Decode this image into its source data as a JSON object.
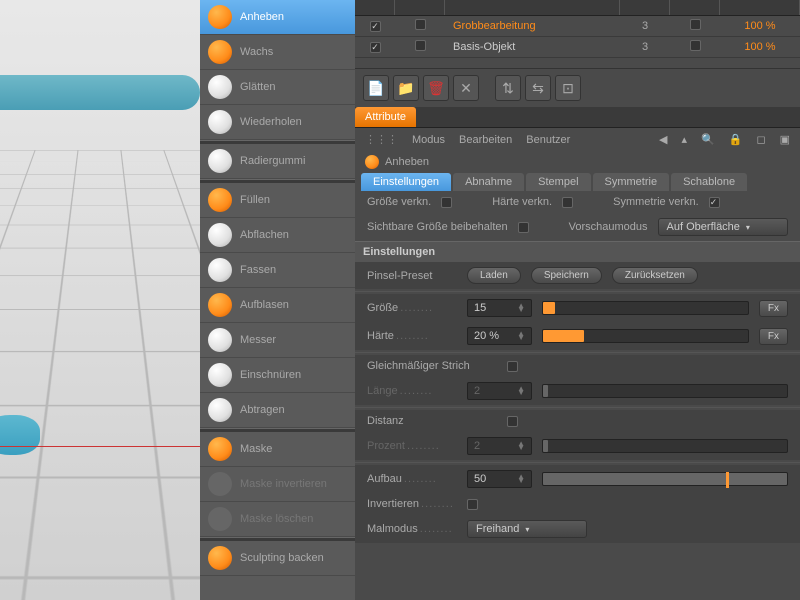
{
  "tools": {
    "group1": [
      {
        "id": "anheben",
        "label": "Anheben",
        "icon": "orange",
        "sel": true
      },
      {
        "id": "wachs",
        "label": "Wachs",
        "icon": "orange"
      },
      {
        "id": "glaetten",
        "label": "Glätten",
        "icon": "white"
      },
      {
        "id": "wiederholen",
        "label": "Wiederholen",
        "icon": "white"
      }
    ],
    "group2": [
      {
        "id": "radiergummi",
        "label": "Radiergummi",
        "icon": "white"
      }
    ],
    "group3": [
      {
        "id": "fuellen",
        "label": "Füllen",
        "icon": "orange"
      },
      {
        "id": "abflachen",
        "label": "Abflachen",
        "icon": "white"
      },
      {
        "id": "fassen",
        "label": "Fassen",
        "icon": "white"
      },
      {
        "id": "aufblasen",
        "label": "Aufblasen",
        "icon": "orange"
      },
      {
        "id": "messer",
        "label": "Messer",
        "icon": "white"
      },
      {
        "id": "einschnueren",
        "label": "Einschnüren",
        "icon": "white"
      },
      {
        "id": "abtragen",
        "label": "Abtragen",
        "icon": "white"
      }
    ],
    "group4": [
      {
        "id": "maske",
        "label": "Maske",
        "icon": "orange"
      },
      {
        "id": "maske-invertieren",
        "label": "Maske invertieren",
        "icon": "gray",
        "dim": true
      },
      {
        "id": "maske-loeschen",
        "label": "Maske löschen",
        "icon": "gray",
        "dim": true
      }
    ],
    "group5": [
      {
        "id": "sculpting-backen",
        "label": "Sculpting backen",
        "icon": "orange"
      }
    ]
  },
  "layers": [
    {
      "name": "Grobbearbeitung",
      "checked": true,
      "num": "3",
      "pct": "100 %",
      "hl": true
    },
    {
      "name": "Basis-Objekt",
      "checked": true,
      "num": "3",
      "pct": "100 %",
      "hl": false
    }
  ],
  "attr": {
    "tab": "Attribute",
    "menu": {
      "modus": "Modus",
      "bearbeiten": "Bearbeiten",
      "benutzer": "Benutzer"
    },
    "title": "Anheben",
    "subtabs": [
      "Einstellungen",
      "Abnahme",
      "Stempel",
      "Symmetrie",
      "Schablone"
    ],
    "row1": {
      "a": "Größe verkn.",
      "b": "Härte verkn.",
      "c": "Symmetrie verkn."
    },
    "row2": {
      "a": "Sichtbare Größe beibehalten",
      "b": "Vorschaumodus",
      "dd": "Auf Oberfläche"
    },
    "section": "Einstellungen",
    "preset": {
      "lbl": "Pinsel-Preset",
      "load": "Laden",
      "save": "Speichern",
      "reset": "Zurücksetzen"
    },
    "groesse": {
      "lbl": "Größe",
      "val": "15",
      "fx": "Fx"
    },
    "haerte": {
      "lbl": "Härte",
      "val": "20 %",
      "fx": "Fx"
    },
    "strich": "Gleichmäßiger Strich",
    "laenge": {
      "lbl": "Länge",
      "val": "2"
    },
    "distanz": "Distanz",
    "prozent": {
      "lbl": "Prozent",
      "val": "2"
    },
    "aufbau": {
      "lbl": "Aufbau",
      "val": "50"
    },
    "invertieren": "Invertieren",
    "malmodus": {
      "lbl": "Malmodus",
      "val": "Freihand"
    }
  }
}
